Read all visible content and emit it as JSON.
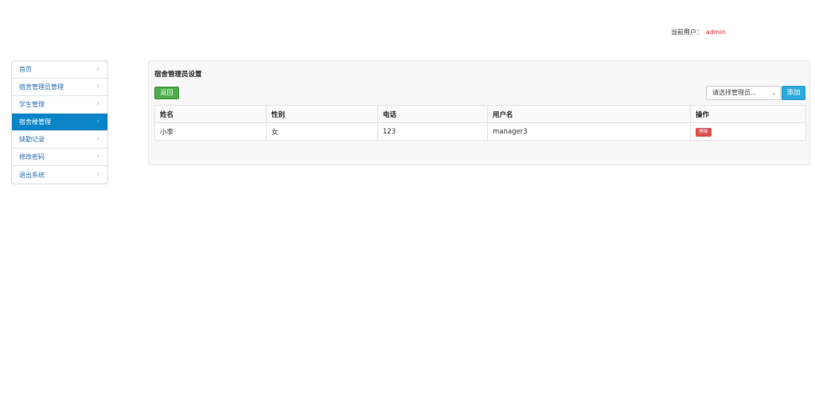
{
  "header": {
    "current_user_label": "当前用户：",
    "current_user": "admin"
  },
  "sidebar": {
    "items": [
      {
        "label": "首页",
        "active": false
      },
      {
        "label": "宿舍管理员管理",
        "active": false
      },
      {
        "label": "学生管理",
        "active": false
      },
      {
        "label": "宿舍楼管理",
        "active": true
      },
      {
        "label": "缺勤记录",
        "active": false
      },
      {
        "label": "修改密码",
        "active": false
      },
      {
        "label": "退出系统",
        "active": false
      }
    ]
  },
  "panel": {
    "title": "宿舍管理员设置",
    "back_label": "返回",
    "select_selected": "请选择管理员...",
    "add_label": "添加"
  },
  "table": {
    "columns": [
      "姓名",
      "性别",
      "电话",
      "用户名",
      "操作"
    ],
    "rows": [
      {
        "name": "小李",
        "gender": "女",
        "phone": "123",
        "username": "manager3",
        "action": "移除"
      }
    ]
  },
  "colors": {
    "accent": "#0a84c7",
    "current_user": "#d9232d",
    "back_button": "#4cae4c",
    "add_button": "#2eaadc",
    "remove_button": "#d9534f"
  }
}
